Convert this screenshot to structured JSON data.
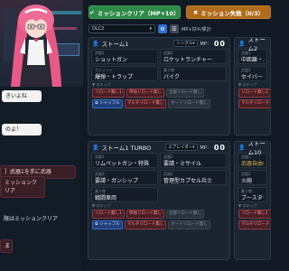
{
  "top": {
    "clear_label": "ミッションクリア（MP+10）",
    "fail_label": "ミッション失敗（0/3）"
  },
  "toolbar": {
    "dlc_select": "DLC2",
    "mp_label": "MP+対⑤/累計"
  },
  "chat": [
    "きいよね",
    "のよ！",
    "］武器1を手に武器",
    "ミッションクリア",
    "限はミッションクリア",
    "ま"
  ],
  "panels": [
    {
      "title": "ストーム1",
      "mode": "シングル",
      "mp_label": "MP：",
      "mp_value": "00",
      "cells": [
        {
          "label": "武器1",
          "value": "ショットガン"
        },
        {
          "label": "武器2",
          "value": "ロケットランチャー"
        },
        {
          "label": "ガジェット",
          "value": "爆弾・トラップ"
        },
        {
          "label": "乗り物",
          "value": "バイク"
        }
      ],
      "skip_label": "▼ スキップ",
      "tags": [
        {
          "text": "リロード無し1",
          "style": "red"
        },
        {
          "text": "単独リロード無し",
          "style": "red"
        },
        {
          "text": "全部リロード無し",
          "style": "grey"
        },
        {
          "text": "✿ シャッフル",
          "style": "blue"
        },
        {
          "text": "マルチリロード無し",
          "style": "red"
        },
        {
          "text": "オートリロード無し",
          "style": "grey"
        }
      ]
    },
    {
      "title": "ストーム1 TURBO",
      "mode": "エアレイダー",
      "mp_label": "MP：",
      "mp_value": "00",
      "cells": [
        {
          "label": "武器1",
          "value": "リムペットガン・特殊"
        },
        {
          "label": "武器2",
          "value": "要請・ミサイル"
        },
        {
          "label": "武器3",
          "value": "要請・ガンシップ"
        },
        {
          "label": "武器4",
          "value": "管理型カプセル兵士"
        },
        {
          "label": "乗り物",
          "value": "戦闘車両"
        }
      ],
      "skip_label": "▼ スキップ",
      "tags": [
        {
          "text": "リロード無し1",
          "style": "red"
        },
        {
          "text": "単独リロード無し",
          "style": "red"
        },
        {
          "text": "全部リロード無し",
          "style": "grey"
        },
        {
          "text": "✿ シャッフル",
          "style": "blue"
        },
        {
          "text": "マルチリロード無し",
          "style": "red"
        },
        {
          "text": "オートリロード無し",
          "style": "grey"
        }
      ]
    },
    {
      "title": "ストーム2",
      "cells": [
        {
          "label": "武器1",
          "value": "中距離・バウ"
        },
        {
          "label": "武器2",
          "value": "セイバー"
        }
      ],
      "skip_label": "▼ スキップ",
      "tags": [
        {
          "text": "リロード無し1",
          "style": "red"
        },
        {
          "text": "マルチリロード無し",
          "style": "red"
        }
      ]
    },
    {
      "title": "ストーム10",
      "cells": [
        {
          "label": "武器1",
          "value": "武器自由枠"
        },
        {
          "label": "武器2",
          "value": "火砲"
        },
        {
          "label": "乗り物",
          "value": "ブースター強化"
        }
      ],
      "skip_label": "▼ スキップ",
      "tags": [
        {
          "text": "リロード無し1",
          "style": "red"
        },
        {
          "text": "マルチリロード無し",
          "style": "red"
        }
      ]
    }
  ],
  "colors": {
    "clear_green": "#2e8a47",
    "fail_orange": "#b06b19",
    "gold_value": "#e6b04a"
  }
}
